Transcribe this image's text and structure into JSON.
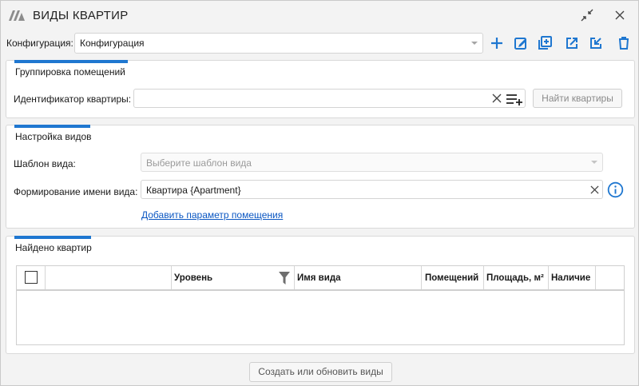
{
  "window": {
    "title": "ВИДЫ КВАРТИР",
    "logo_icon": "logo-icon",
    "collapse_icon": "collapse-icon",
    "close_icon": "close-icon"
  },
  "config": {
    "label": "Конфигурация:",
    "value": "Конфигурация",
    "actions": [
      "add-icon",
      "edit-icon",
      "duplicate-icon",
      "export-icon",
      "import-icon",
      "delete-icon"
    ]
  },
  "grouping": {
    "title": "Группировка помещений",
    "id_label": "Идентификатор квартиры:",
    "id_value": "",
    "find_button": "Найти квартиры"
  },
  "views": {
    "title": "Настройка видов",
    "template_label": "Шаблон вида:",
    "template_placeholder": "Выберите шаблон вида",
    "name_label": "Формирование имени вида:",
    "name_value": "Квартира {Apartment}",
    "add_param_link": "Добавить параметр помещения"
  },
  "found": {
    "title": "Найдено квартир",
    "columns": [
      "",
      "Уровень",
      "Имя вида",
      "Помещений",
      "Площадь, м²",
      "Наличие"
    ],
    "rows": []
  },
  "footer": {
    "create_button": "Создать или обновить виды"
  },
  "colors": {
    "accent": "#1f77d0",
    "link": "#0a56c2"
  }
}
